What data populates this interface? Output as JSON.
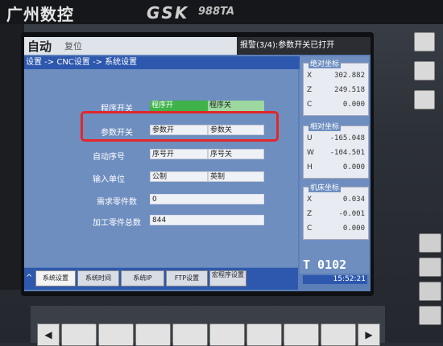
{
  "brand": {
    "name_cn": "广州数控",
    "logo": "GSK",
    "model": "988TA"
  },
  "header": {
    "mode": "自动",
    "reset": "复位",
    "alarm": "报警(3/4):参数开关已打开"
  },
  "breadcrumb": "设置 -> CNC设置 -> 系统设置",
  "settings": {
    "program_switch": {
      "label": "程序开关",
      "opt_on": "程序开",
      "opt_off": "程序关"
    },
    "param_switch": {
      "label": "参数开关",
      "opt_on": "参数开",
      "opt_off": "参数关"
    },
    "auto_seq": {
      "label": "自动序号",
      "opt_on": "序号开",
      "opt_off": "序号关"
    },
    "input_unit": {
      "label": "输入单位",
      "opt_metric": "公制",
      "opt_inch": "英制"
    },
    "required_parts": {
      "label": "需求零件数",
      "value": "0"
    },
    "total_parts": {
      "label": "加工零件总数",
      "value": "844"
    }
  },
  "coords": {
    "absolute": {
      "title": "绝对坐标",
      "rows": [
        {
          "axis": "X",
          "value": "302.882"
        },
        {
          "axis": "Z",
          "value": "249.518"
        },
        {
          "axis": "C",
          "value": "0.000"
        }
      ]
    },
    "relative": {
      "title": "相对坐标",
      "rows": [
        {
          "axis": "U",
          "value": "-165.048"
        },
        {
          "axis": "W",
          "value": "-104.501"
        },
        {
          "axis": "H",
          "value": "0.000"
        }
      ]
    },
    "machine": {
      "title": "机床坐标",
      "rows": [
        {
          "axis": "X",
          "value": "0.034"
        },
        {
          "axis": "Z",
          "value": "-0.001"
        },
        {
          "axis": "C",
          "value": "0.000"
        }
      ]
    }
  },
  "tool": "T 0102",
  "clock": "15:52:21",
  "softkeys": {
    "arrow": "^",
    "k1": "系统设置",
    "k2": "系统时间",
    "k3": "系统IP",
    "k4": "FTP设置",
    "k5": "宏程序设置"
  },
  "colors": {
    "screen_bg": "#6e8ec0",
    "title_bar": "#2d58ad",
    "highlight_green": "#3fb24a",
    "annotation_red": "#e3262a"
  }
}
